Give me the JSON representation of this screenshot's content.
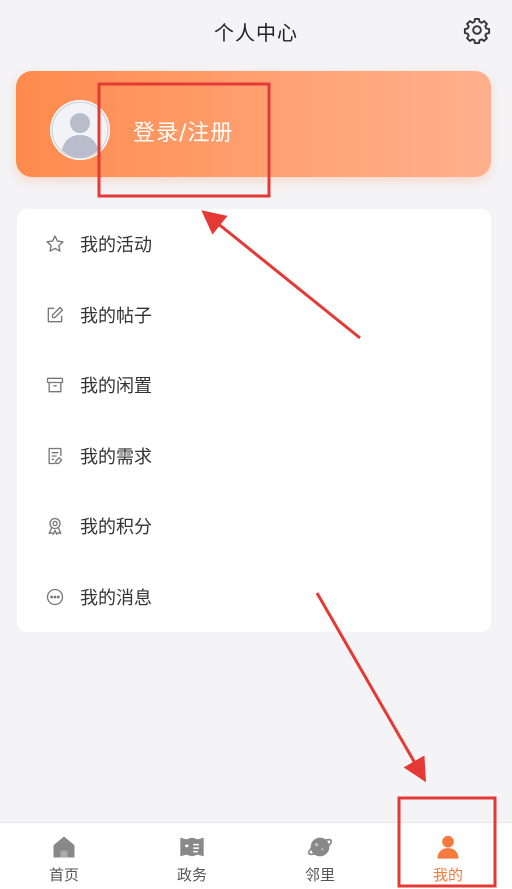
{
  "header": {
    "title": "个人中心",
    "settings_icon": "gear-icon"
  },
  "login": {
    "label": "登录/注册",
    "avatar_icon": "user-avatar-icon"
  },
  "menu": {
    "items": [
      {
        "label": "我的活动",
        "icon": "star-icon"
      },
      {
        "label": "我的帖子",
        "icon": "edit-icon"
      },
      {
        "label": "我的闲置",
        "icon": "box-icon"
      },
      {
        "label": "我的需求",
        "icon": "document-icon"
      },
      {
        "label": "我的积分",
        "icon": "medal-icon"
      },
      {
        "label": "我的消息",
        "icon": "chat-icon"
      }
    ]
  },
  "tabbar": {
    "tabs": [
      {
        "label": "首页",
        "icon": "home-icon",
        "active": false
      },
      {
        "label": "政务",
        "icon": "news-icon",
        "active": false
      },
      {
        "label": "邻里",
        "icon": "planet-icon",
        "active": false
      },
      {
        "label": "我的",
        "icon": "person-icon",
        "active": true
      }
    ]
  },
  "colors": {
    "accent": "#f47a3e",
    "gradient_start": "#ff8a4c",
    "gradient_end": "#ffb08c",
    "annotation": "#e53935"
  }
}
